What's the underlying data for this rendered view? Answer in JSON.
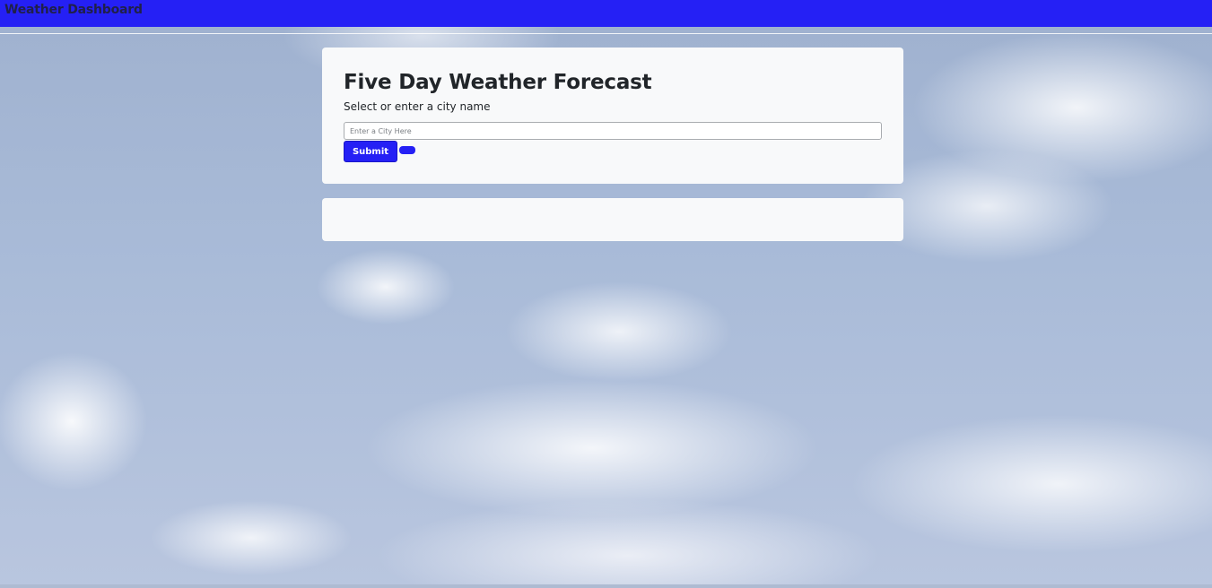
{
  "navbar": {
    "brand": "Weather Dashboard",
    "color": "#2520f5"
  },
  "search_card": {
    "title": "Five Day Weather Forecast",
    "subtitle": "Select or enter a city name",
    "city_input": {
      "placeholder": "Enter a City Here",
      "value": ""
    },
    "submit_label": "Submit",
    "clear_label": ""
  },
  "results_card": {
    "content": ""
  },
  "background": {
    "icon": "sky-clouds-photo"
  }
}
